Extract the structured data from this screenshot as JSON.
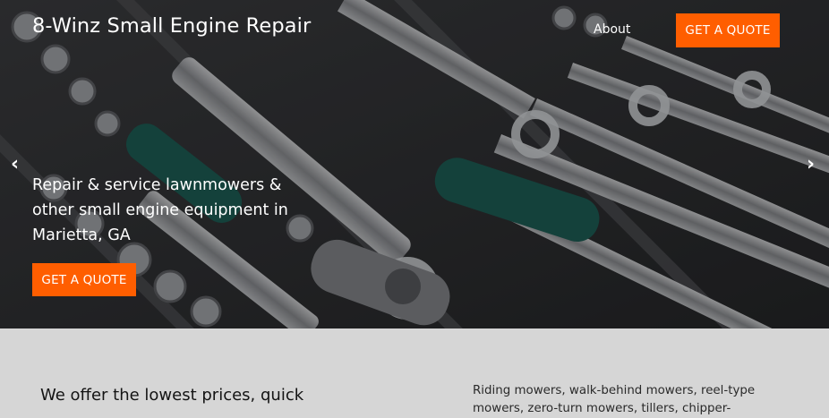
{
  "header": {
    "site_title": "8-Winz Small Engine Repair",
    "nav": {
      "about_label": "About"
    },
    "quote_label": "GET A QUOTE"
  },
  "hero": {
    "tagline": "Repair & service lawnmowers & other small engine equipment in Marietta, GA",
    "cta_label": "GET A QUOTE",
    "prev_arrow": "‹",
    "next_arrow": "›",
    "background_image": "wrench-and-socket-set-photo"
  },
  "intro": {
    "heading": "We offer the lowest prices, quick",
    "services_text": "Riding mowers, walk-behind mowers, reel-type mowers, zero-turn mowers, tillers, chipper-"
  },
  "colors": {
    "accent": "#ff5e00",
    "lower_background": "#d6d6d6",
    "text_light": "#ffffff"
  }
}
